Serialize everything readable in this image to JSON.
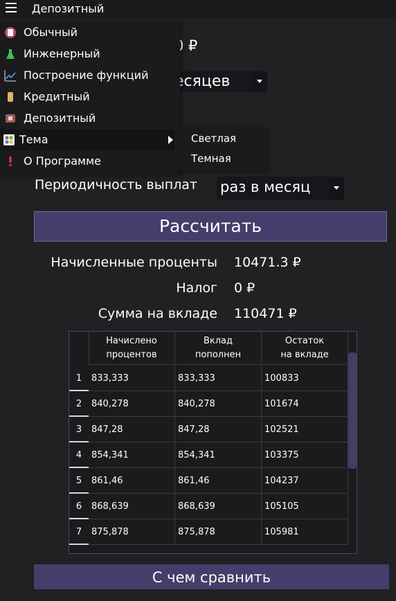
{
  "header": {
    "title": "Депозитный",
    "menu_icon": "hamburger-icon"
  },
  "form": {
    "amount_tail": "0 ₽",
    "term_value": "есяцев",
    "period_label": "Периодичность выплат",
    "period_value": "раз в месяц",
    "calc_button": "Рассчитать"
  },
  "results": {
    "interest_label": "Начисленные проценты",
    "interest_value": "10471.3 ₽",
    "tax_label": "Налог",
    "tax_value": "0 ₽",
    "sum_label": "Сумма на вкладе",
    "sum_value": "110471 ₽"
  },
  "table": {
    "headers": [
      "Начислено\nпроцентов",
      "Вклад\nпополнен",
      "Остаток\nна вкладе"
    ],
    "rows": [
      {
        "n": "1",
        "interest": "833,333",
        "added": "833,333",
        "balance": "100833"
      },
      {
        "n": "2",
        "interest": "840,278",
        "added": "840,278",
        "balance": "101674"
      },
      {
        "n": "3",
        "interest": "847,28",
        "added": "847,28",
        "balance": "102521"
      },
      {
        "n": "4",
        "interest": "854,341",
        "added": "854,341",
        "balance": "103375"
      },
      {
        "n": "5",
        "interest": "861,46",
        "added": "861,46",
        "balance": "104237"
      },
      {
        "n": "6",
        "interest": "868,639",
        "added": "868,639",
        "balance": "105105"
      },
      {
        "n": "7",
        "interest": "875,878",
        "added": "875,878",
        "balance": "105981"
      }
    ]
  },
  "compare_button": "С чем сравнить",
  "menu": {
    "items": [
      {
        "label": "Обычный",
        "icon": "calculator-icon"
      },
      {
        "label": "Инженерный",
        "icon": "flask-icon"
      },
      {
        "label": "Построение функций",
        "icon": "chart-line-icon"
      },
      {
        "label": "Кредитный",
        "icon": "credit-icon"
      },
      {
        "label": "Депозитный",
        "icon": "deposit-icon"
      },
      {
        "label": "Тема",
        "icon": "palette-icon"
      },
      {
        "label": "О Программе",
        "icon": "exclamation-icon"
      }
    ],
    "submenu": [
      "Светлая",
      "Темная"
    ]
  },
  "colors": {
    "background": "#212023",
    "button": "#433f6a",
    "panel": "#1b1a1d"
  }
}
